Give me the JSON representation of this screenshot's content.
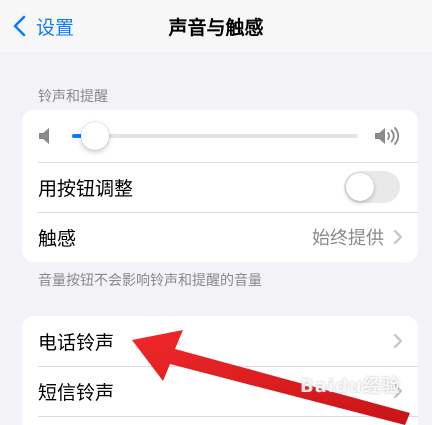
{
  "nav": {
    "back_label": "设置",
    "title": "声音与触感"
  },
  "ringer_section": {
    "header": "铃声和提醒",
    "volume_level": 0.08,
    "button_adjust_label": "用按钮调整",
    "button_adjust_on": false,
    "haptics_label": "触感",
    "haptics_value": "始终提供",
    "footer": "音量按钮不会影响铃声和提醒的音量"
  },
  "sounds_section": {
    "ringtone_label": "电话铃声",
    "text_tone_label": "短信铃声"
  },
  "colors": {
    "accent": "#0a7cff",
    "annotation_arrow": "#e8191b"
  },
  "watermark": "Baidu经验"
}
